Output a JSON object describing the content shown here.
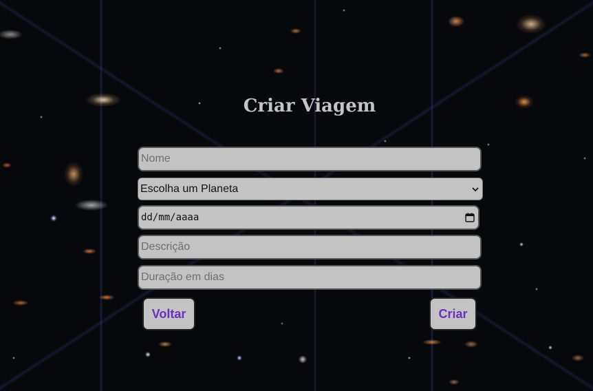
{
  "form": {
    "title": "Criar Viagem",
    "nome_placeholder": "Nome",
    "planeta_selected": "Escolha um Planeta",
    "data_placeholder": "dd/mm/aaaa",
    "descricao_placeholder": "Descrição",
    "duracao_placeholder": "Duração em dias"
  },
  "buttons": {
    "voltar": "Voltar",
    "criar": "Criar"
  },
  "colors": {
    "field_background": "#c3c3c3",
    "button_text": "#6b2fbf",
    "title_text": "#c4c4c4"
  },
  "icons": {
    "select_arrow": "chevron-down-icon",
    "date_picker": "calendar-icon"
  }
}
